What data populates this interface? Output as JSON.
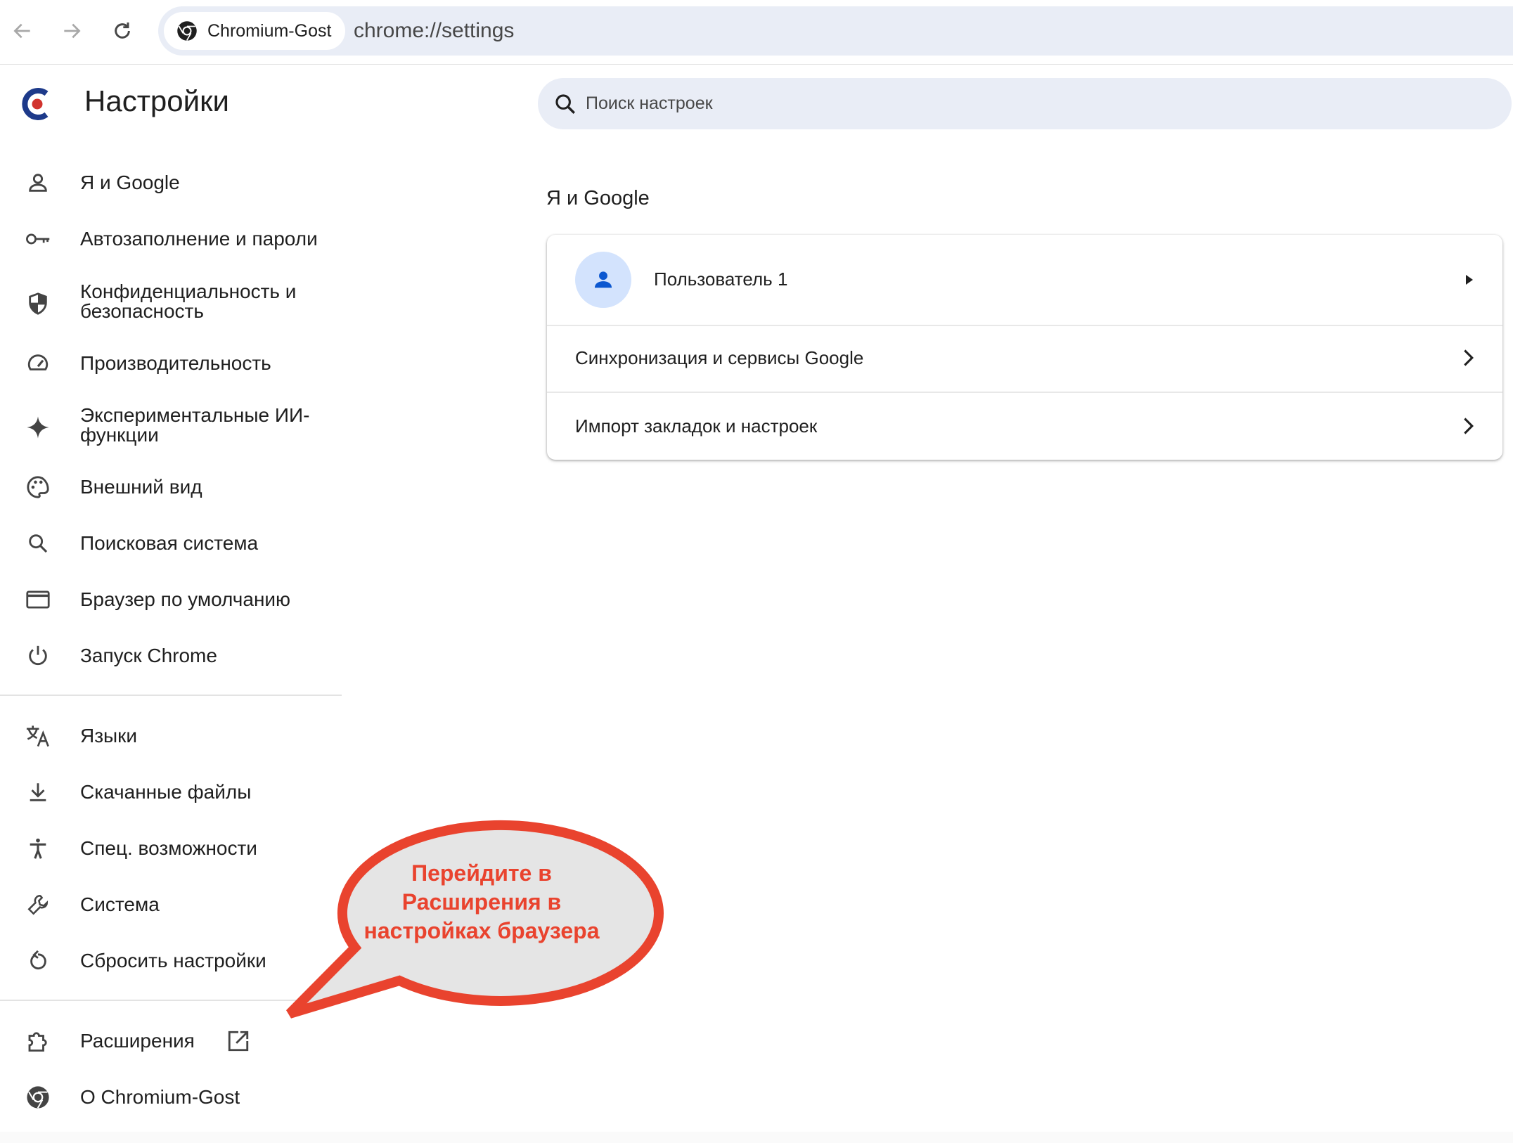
{
  "toolbar": {
    "site_name": "Chromium-Gost",
    "url": "chrome://settings"
  },
  "header": {
    "title": "Настройки",
    "search_placeholder": "Поиск настроек"
  },
  "sidebar": {
    "items": [
      {
        "label": "Я и Google",
        "icon": "person-icon"
      },
      {
        "label": "Автозаполнение и пароли",
        "icon": "key-icon"
      },
      {
        "label": "Конфиденциальность и безопасность",
        "icon": "shield-icon"
      },
      {
        "label": "Производительность",
        "icon": "speedometer-icon"
      },
      {
        "label": "Экспериментальные ИИ-функции",
        "icon": "sparkle-icon"
      },
      {
        "label": "Внешний вид",
        "icon": "palette-icon"
      },
      {
        "label": "Поисковая система",
        "icon": "search-icon"
      },
      {
        "label": "Браузер по умолчанию",
        "icon": "browser-window-icon"
      },
      {
        "label": "Запуск Chrome",
        "icon": "power-icon"
      },
      {
        "label": "Языки",
        "icon": "translate-icon"
      },
      {
        "label": "Скачанные файлы",
        "icon": "download-icon"
      },
      {
        "label": "Спец. возможности",
        "icon": "accessibility-icon"
      },
      {
        "label": "Система",
        "icon": "wrench-icon"
      },
      {
        "label": "Сбросить настройки",
        "icon": "reset-icon"
      },
      {
        "label": "Расширения",
        "icon": "puzzle-icon"
      },
      {
        "label": "О Chromium-Gost",
        "icon": "chromium-icon"
      }
    ]
  },
  "main": {
    "section_title": "Я и Google",
    "rows": [
      {
        "label": "Пользователь 1"
      },
      {
        "label": "Синхронизация и сервисы Google"
      },
      {
        "label": "Импорт закладок и настроек"
      }
    ]
  },
  "callout": {
    "text_lines": [
      "Перейдите в",
      "Расширения в",
      "настройках браузера"
    ]
  },
  "colors": {
    "accent": "#0b57d0",
    "callout_red": "#e9432e",
    "callout_fill": "#e5e5e5",
    "omnibox_bg": "#e9edf6",
    "avatar_bg": "#d3e3fd"
  }
}
